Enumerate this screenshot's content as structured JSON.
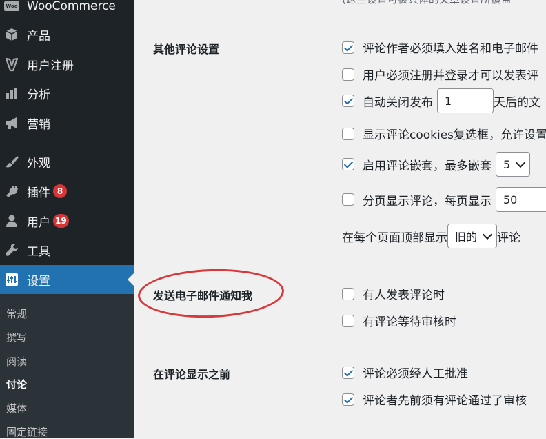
{
  "sidebar": {
    "menu": [
      {
        "id": "woocommerce",
        "label": "WooCommerce",
        "icon": "woocommerce-icon"
      },
      {
        "id": "products",
        "label": "产品",
        "icon": "cube-icon"
      },
      {
        "id": "registration",
        "label": "用户注册",
        "icon": "user-registration-icon"
      },
      {
        "id": "analytics",
        "label": "分析",
        "icon": "bar-chart-icon"
      },
      {
        "id": "marketing",
        "label": "营销",
        "icon": "megaphone-icon"
      },
      {
        "id": "appearance",
        "label": "外观",
        "icon": "paintbrush-icon"
      },
      {
        "id": "plugins",
        "label": "插件",
        "icon": "plug-icon",
        "badge": "8"
      },
      {
        "id": "users",
        "label": "用户",
        "icon": "user-icon",
        "badge": "19"
      },
      {
        "id": "tools",
        "label": "工具",
        "icon": "wrench-icon"
      },
      {
        "id": "settings",
        "label": "设置",
        "icon": "settings-icon",
        "active": true
      }
    ],
    "submenu": [
      "常规",
      "撰写",
      "阅读",
      "讨论",
      "媒体",
      "固定链接"
    ],
    "submenu_current": "讨论",
    "woo_icon_text": "Woo"
  },
  "main": {
    "top_desc": "(这些设置可被具体的文章设置所覆盖",
    "sections": {
      "other_comment": {
        "title": "其他评论设置",
        "opt1": "评论作者必须填入姓名和电子邮件",
        "opt2": "用户必须注册并登录才可以发表评",
        "opt3_before": "自动关闭发布",
        "opt3_value": "1",
        "opt3_after": "天后的文",
        "opt4": "显示评论cookies复选框，允许设置",
        "opt5": "启用评论嵌套，最多嵌套",
        "opt5_value": "5",
        "opt6": "分页显示评论，每页显示",
        "opt6_value": "50",
        "opt7_before": "在每个页面顶部显示",
        "opt7_value": "旧的",
        "opt7_after": "评论"
      },
      "email_notify": {
        "title": "发送电子邮件通知我",
        "opt1": "有人发表评论时",
        "opt2": "有评论等待审核时"
      },
      "before_display": {
        "title": "在评论显示之前",
        "opt1": "评论必须经人工批准",
        "opt2": "评论者先前须有评论通过了审核"
      }
    }
  },
  "colors": {
    "sidebar_bg": "#1d2327",
    "submenu_bg": "#2c3338",
    "active_blue": "#2271b1",
    "badge_red": "#d63638",
    "annotation_red": "#d9383a",
    "content_bg": "#f0f0f1"
  }
}
